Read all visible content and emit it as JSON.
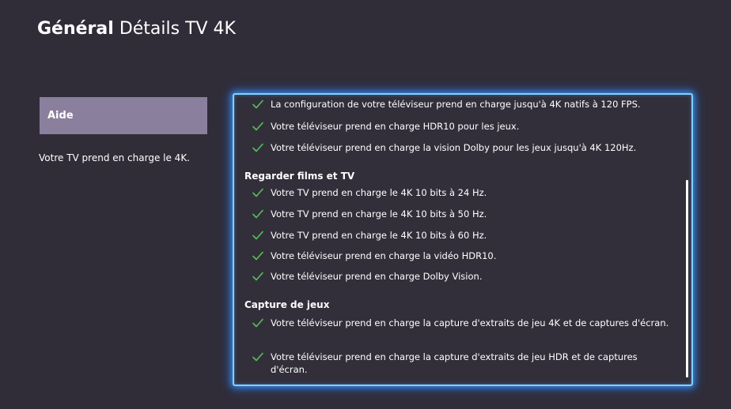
{
  "header": {
    "section": "Général",
    "page": "Détails TV 4K"
  },
  "sidebar": {
    "help_button": "Aide",
    "description": "Votre TV prend en charge le 4K."
  },
  "details": {
    "items_top": [
      "La configuration de votre téléviseur prend en charge jusqu'à 4K natifs à 120 FPS.",
      "Votre téléviseur prend en charge HDR10 pour les jeux.",
      "Votre téléviseur prend en charge la vision Dolby pour les jeux jusqu'à 4K 120Hz."
    ],
    "section_films": {
      "title": "Regarder films et TV",
      "items": [
        "Votre TV prend en charge le 4K 10 bits à 24 Hz.",
        "Votre TV prend en charge le 4K 10 bits à 50 Hz.",
        "Votre TV prend en charge le 4K 10 bits à 60 Hz.",
        "Votre téléviseur prend en charge la vidéo HDR10.",
        "Votre téléviseur prend en charge Dolby Vision."
      ]
    },
    "section_capture": {
      "title": "Capture de jeux",
      "items": [
        "Votre téléviseur prend en charge la capture d'extraits de jeu 4K et de captures d'écran.",
        "Votre téléviseur prend en charge la capture d'extraits de jeu HDR et de captures d'écran."
      ]
    }
  },
  "icons": {
    "check": "check-icon"
  },
  "colors": {
    "background": "#302d39",
    "help_button": "#8a7f9c",
    "check": "#56c254",
    "focus_border": "#7fd2ff"
  }
}
